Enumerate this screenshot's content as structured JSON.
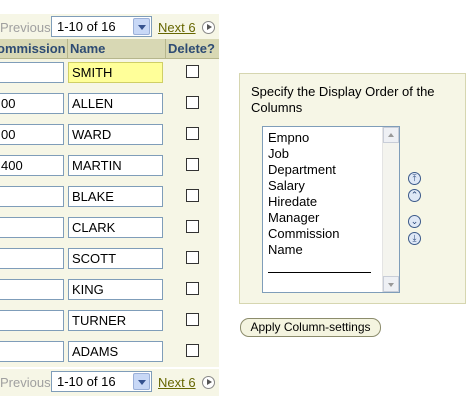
{
  "pager": {
    "previous": "Previous",
    "range_value": "1-10 of 16",
    "next": "Next 6"
  },
  "table": {
    "headers": {
      "commission": "ommission",
      "name": "Name",
      "delete": "Delete?"
    },
    "rows": [
      {
        "commission": "",
        "name": "SMITH"
      },
      {
        "commission": "00",
        "name": "ALLEN"
      },
      {
        "commission": "00",
        "name": "WARD"
      },
      {
        "commission": "400",
        "name": "MARTIN"
      },
      {
        "commission": "",
        "name": "BLAKE"
      },
      {
        "commission": "",
        "name": "CLARK"
      },
      {
        "commission": "",
        "name": "SCOTT"
      },
      {
        "commission": "",
        "name": "KING"
      },
      {
        "commission": "",
        "name": "TURNER"
      },
      {
        "commission": "",
        "name": "ADAMS"
      }
    ]
  },
  "display_order": {
    "title": "Specify the Display Order of the Columns",
    "items": [
      "Empno",
      "Job",
      "Department",
      "Salary",
      "Hiredate",
      "Manager",
      "Commission",
      "Name"
    ]
  },
  "apply_button": "Apply Column-settings",
  "icons": [
    "next-icon",
    "move-top-icon",
    "move-up-icon",
    "move-down-icon",
    "move-bottom-icon",
    "dropdown-arrow-icon"
  ],
  "colors": {
    "header_bg": "#d8d8b4",
    "header_text": "#2d4b73",
    "panel_bg": "#f6f6e6",
    "highlight": "#ffff99",
    "link": "#666600"
  }
}
